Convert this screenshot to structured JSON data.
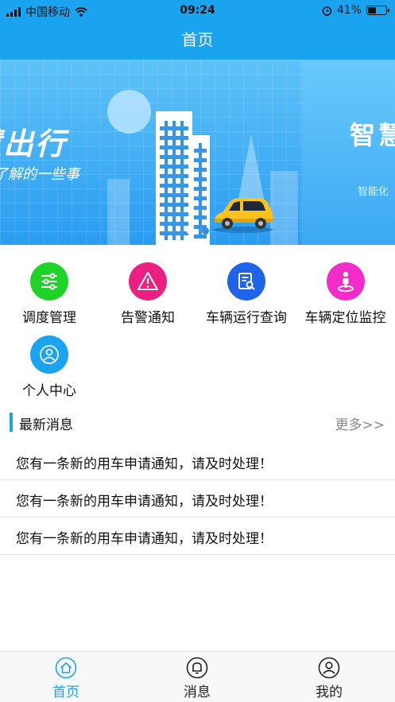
{
  "status_bar": {
    "carrier": "中国移动",
    "time": "09:24",
    "battery": "41%",
    "battery_level": 0.41
  },
  "navbar": {
    "title": "首页"
  },
  "banner": {
    "slide1_title": "智慧出行",
    "slide1_subtitle": "了解的一些事",
    "slide2_title": "智慧",
    "slide2_subtitle": "智能化",
    "slide_count": 2,
    "active_slide": 1
  },
  "menu": [
    {
      "label": "调度管理",
      "icon": "sliders-icon",
      "color": "#1fd327"
    },
    {
      "label": "告警通知",
      "icon": "warning-icon",
      "color": "#ec1f82"
    },
    {
      "label": "车辆运行查询",
      "icon": "document-search-icon",
      "color": "#1f64e8"
    },
    {
      "label": "车辆定位监控",
      "icon": "location-person-icon",
      "color": "#f22cc9"
    },
    {
      "label": "个人中心",
      "icon": "user-icon",
      "color": "#1aa4f0"
    }
  ],
  "news": {
    "title": "最新消息",
    "more": "更多>>",
    "items": [
      "您有一条新的用车申请通知，请及时处理！",
      "您有一条新的用车申请通知，请及时处理！",
      "您有一条新的用车申请通知，请及时处理！"
    ]
  },
  "tabbar": {
    "active_color": "#1aa4f0",
    "items": [
      {
        "label": "首页",
        "icon": "home-icon",
        "active": true
      },
      {
        "label": "消息",
        "icon": "bell-icon",
        "active": false
      },
      {
        "label": "我的",
        "icon": "profile-icon",
        "active": false
      }
    ]
  }
}
